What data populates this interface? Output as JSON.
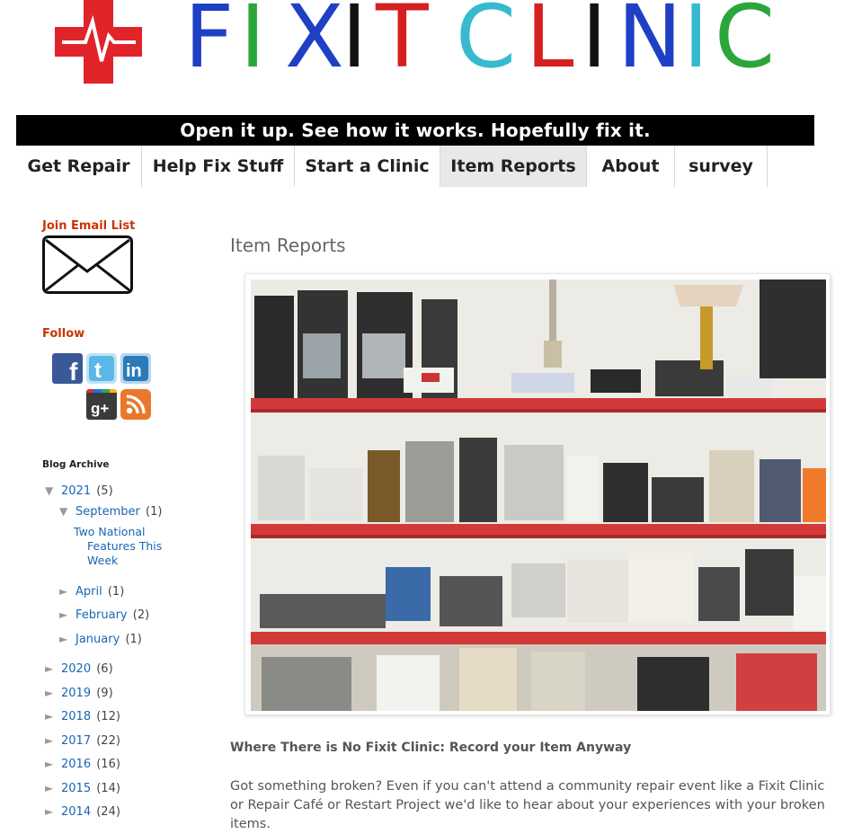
{
  "header": {
    "logo_letters": [
      {
        "ch": "F",
        "color": "#1f3fc4"
      },
      {
        "ch": "I",
        "color": "#2aa63a"
      },
      {
        "ch": "X",
        "color": "#1f3fc4"
      },
      {
        "ch": "I",
        "color": "#111111"
      },
      {
        "ch": "T",
        "color": "#d42020"
      },
      {
        "ch": "C",
        "color": "#37b9cf"
      },
      {
        "ch": "L",
        "color": "#d42020"
      },
      {
        "ch": "I",
        "color": "#111111"
      },
      {
        "ch": "N",
        "color": "#1f3fc4"
      },
      {
        "ch": "I",
        "color": "#37b9cf"
      },
      {
        "ch": "C",
        "color": "#2aa63a"
      }
    ],
    "tagline": "Open it up. See how it works. Hopefully fix it."
  },
  "nav": {
    "tabs": [
      {
        "label": "Get Repair"
      },
      {
        "label": "Help Fix Stuff"
      },
      {
        "label": "Start a Clinic"
      },
      {
        "label": "Item Reports",
        "active": true
      },
      {
        "label": "About"
      },
      {
        "label": "survey"
      }
    ]
  },
  "sidebar": {
    "join_email_heading": "Join Email List",
    "follow_heading": "Follow",
    "social": [
      {
        "icon": "facebook-icon",
        "glyph": "f",
        "color": "#3b5998"
      },
      {
        "icon": "twitter-icon",
        "glyph": "t",
        "color": "#4fb3e8"
      },
      {
        "icon": "linkedin-icon",
        "glyph": "in",
        "color": "#2a7bb8"
      },
      {
        "icon": "google-plus-icon",
        "glyph": "g+",
        "color": "#3a3a3a"
      },
      {
        "icon": "rss-icon",
        "glyph": "rss",
        "color": "#e8792b"
      }
    ],
    "archive_heading": "Blog Archive",
    "archive": {
      "expanded_toggle": "▼",
      "collapsed_toggle": "►",
      "y2021": {
        "year": "2021",
        "count": "(5)"
      },
      "september": {
        "month": "September",
        "count": "(1)"
      },
      "post": "Two National Features This Week",
      "april": {
        "month": "April",
        "count": "(1)"
      },
      "february": {
        "month": "February",
        "count": "(2)"
      },
      "january": {
        "month": "January",
        "count": "(1)"
      },
      "y2020": {
        "year": "2020",
        "count": "(6)"
      },
      "y2019": {
        "year": "2019",
        "count": "(9)"
      },
      "y2018": {
        "year": "2018",
        "count": "(12)"
      },
      "y2017": {
        "year": "2017",
        "count": "(22)"
      },
      "y2016": {
        "year": "2016",
        "count": "(16)"
      },
      "y2015": {
        "year": "2015",
        "count": "(14)"
      },
      "y2014": {
        "year": "2014",
        "count": "(24)"
      }
    }
  },
  "main": {
    "page_title": "Item Reports",
    "subheading": "Where There is No Fixit Clinic: Record your Item Anyway",
    "body": "Got something broken? Even if you can't attend a community repair event like a Fixit Clinic or Repair Café or Restart Project we'd like to hear about your experiences with your broken items."
  },
  "colors": {
    "accent_red": "#cc3300",
    "link_blue": "#1a66b3",
    "cross_red": "#e0242a"
  }
}
